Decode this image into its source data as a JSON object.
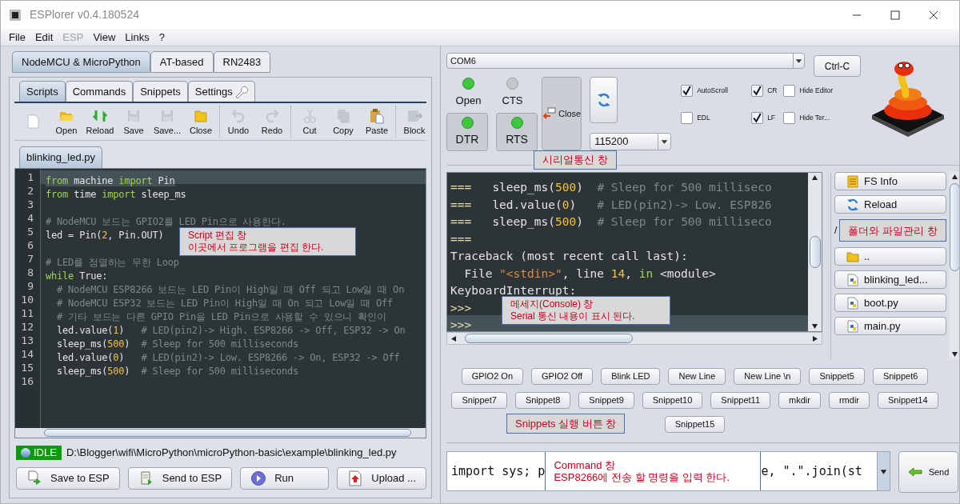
{
  "window": {
    "title": "ESPlorer v0.4.180524"
  },
  "menu": [
    {
      "label": "File",
      "disabled": false
    },
    {
      "label": "Edit",
      "disabled": false
    },
    {
      "label": "ESP",
      "disabled": true
    },
    {
      "label": "View",
      "disabled": false
    },
    {
      "label": "Links",
      "disabled": false
    },
    {
      "label": "?",
      "disabled": false
    }
  ],
  "device_tabs": [
    {
      "label": "NodeMCU & MicroPython",
      "selected": true
    },
    {
      "label": "AT-based",
      "selected": false
    },
    {
      "label": "RN2483",
      "selected": false
    }
  ],
  "editor_tabs": [
    {
      "label": "Scripts",
      "selected": true
    },
    {
      "label": "Commands",
      "selected": false
    },
    {
      "label": "Snippets",
      "selected": false
    },
    {
      "label": "Settings",
      "selected": false,
      "kind": "settings"
    }
  ],
  "toolbar_groups": [
    {
      "items": [
        {
          "kind": "new",
          "disabled": false
        },
        {
          "kind": "open",
          "label": "Open",
          "disabled": false
        },
        {
          "kind": "reload",
          "label": "Reload",
          "disabled": false
        },
        {
          "kind": "save",
          "label": "Save",
          "disabled": true
        },
        {
          "kind": "saveas",
          "label": "Save...",
          "disabled": true
        },
        {
          "kind": "close",
          "label": "Close",
          "disabled": false
        }
      ]
    },
    {
      "items": [
        {
          "kind": "undo",
          "label": "Undo",
          "disabled": true
        },
        {
          "kind": "redo",
          "label": "Redo",
          "disabled": true
        }
      ]
    },
    {
      "items": [
        {
          "kind": "cut",
          "label": "Cut",
          "disabled": true
        },
        {
          "kind": "copy",
          "label": "Copy",
          "disabled": true
        },
        {
          "kind": "paste",
          "label": "Paste",
          "disabled": false
        }
      ]
    },
    {
      "items": [
        {
          "kind": "block",
          "label": "Block",
          "disabled": true
        }
      ]
    }
  ],
  "file_tabs": [
    {
      "label": "blinking_led.py",
      "selected": true
    }
  ],
  "editor": {
    "note": [
      "Script 편집 창",
      "이곳에서 프로그램을 편집 한다."
    ],
    "lines": [
      {
        "number": "1",
        "current": true,
        "tokens": [
          {
            "kind": "keyword",
            "text": "from"
          },
          {
            "kind": "text",
            "text": " machine "
          },
          {
            "kind": "keyword",
            "text": "import"
          },
          {
            "kind": "text",
            "text": " Pin"
          }
        ]
      },
      {
        "number": "2",
        "current": false,
        "tokens": [
          {
            "kind": "keyword",
            "text": "from"
          },
          {
            "kind": "text",
            "text": " time "
          },
          {
            "kind": "keyword",
            "text": "import"
          },
          {
            "kind": "text",
            "text": " sleep_ms"
          }
        ]
      },
      {
        "number": "3"
      },
      {
        "number": "4",
        "current": false,
        "tokens": [
          {
            "kind": "comment",
            "text": "# NodeMCU 보드는 GPIO2를 LED Pin으로 사용한다."
          }
        ]
      },
      {
        "number": "5",
        "current": false,
        "tokens": [
          {
            "kind": "text",
            "text": "led = Pin("
          },
          {
            "kind": "number",
            "text": "2"
          },
          {
            "kind": "text",
            "text": ", Pin.OUT)"
          }
        ]
      },
      {
        "number": "6"
      },
      {
        "number": "7",
        "current": false,
        "tokens": [
          {
            "kind": "comment",
            "text": "# LED를 점멸하는 무한 Loop"
          }
        ]
      },
      {
        "number": "8",
        "current": false,
        "tokens": [
          {
            "kind": "keyword",
            "text": "while"
          },
          {
            "kind": "text",
            "text": " True:"
          }
        ]
      },
      {
        "number": "9",
        "current": false,
        "tokens": [
          {
            "kind": "comment",
            "text": "  # NodeMCU ESP8266 보드는 LED Pin이 High일 때 Off 되고 Low일 때 On"
          }
        ]
      },
      {
        "number": "10",
        "current": false,
        "tokens": [
          {
            "kind": "comment",
            "text": "  # NodeMCU ESP32 보드는 LED Pin이 High일 때 On 되고 Low일 때 Off"
          }
        ]
      },
      {
        "number": "11",
        "current": false,
        "tokens": [
          {
            "kind": "comment",
            "text": "  # 기타 보드는 다른 GPIO Pin을 LED Pin으로 사용할 수 있으니 확인이"
          }
        ]
      },
      {
        "number": "12",
        "current": false,
        "tokens": [
          {
            "kind": "text",
            "text": "  led.value("
          },
          {
            "kind": "number",
            "text": "1"
          },
          {
            "kind": "text",
            "text": ")   "
          },
          {
            "kind": "comment",
            "text": "# LED(pin2)-> High. ESP8266 -> Off, ESP32 -> On"
          }
        ]
      },
      {
        "number": "13",
        "current": false,
        "tokens": [
          {
            "kind": "text",
            "text": "  sleep_ms("
          },
          {
            "kind": "number",
            "text": "500"
          },
          {
            "kind": "text",
            "text": ")  "
          },
          {
            "kind": "comment",
            "text": "# Sleep for 500 milliseconds"
          }
        ]
      },
      {
        "number": "14",
        "current": false,
        "tokens": [
          {
            "kind": "text",
            "text": "  led.value("
          },
          {
            "kind": "number",
            "text": "0"
          },
          {
            "kind": "text",
            "text": ")   "
          },
          {
            "kind": "comment",
            "text": "# LED(pin2)-> Low. ESP8266 -> On, ESP32 -> Off"
          }
        ]
      },
      {
        "number": "15",
        "current": false,
        "tokens": [
          {
            "kind": "text",
            "text": "  sleep_ms("
          },
          {
            "kind": "number",
            "text": "500"
          },
          {
            "kind": "text",
            "text": ")  "
          },
          {
            "kind": "comment",
            "text": "# Sleep for 500 milliseconds"
          }
        ]
      },
      {
        "number": "16"
      }
    ]
  },
  "status": {
    "state": "IDLE",
    "path": "D:\\Blogger\\wifi\\MicroPython\\microPython-basic\\example\\blinking_led.py"
  },
  "script_buttons": [
    {
      "kind": "save",
      "label": "Save to ESP"
    },
    {
      "kind": "send",
      "label": "Send to ESP"
    },
    {
      "kind": "run",
      "label": "Run"
    },
    {
      "kind": "upload",
      "label": "Upload ..."
    }
  ],
  "serial": {
    "port": "COM6",
    "ctrl_c": "Ctrl-C",
    "close": "Close",
    "baud": "115200",
    "note": "시리얼통신 창",
    "indicators": [
      {
        "label": "Open",
        "on": true
      },
      {
        "label": "CTS",
        "on": false
      }
    ],
    "line_buttons": [
      {
        "label": "DTR",
        "on": true
      },
      {
        "label": "RTS",
        "on": true
      }
    ],
    "options": [
      {
        "label": "AutoScroll",
        "checked": true
      },
      {
        "label": "CR",
        "checked": true
      },
      {
        "label": "Hide Editor",
        "checked": false
      },
      {
        "label": "EDL",
        "checked": false
      },
      {
        "label": "LF",
        "checked": true
      },
      {
        "label": "Hide Ter...",
        "checked": false
      }
    ]
  },
  "console": {
    "note": [
      "메세지(Console) 창",
      "Serial 통신 내용이 표시 된다."
    ],
    "lines": [
      {
        "current": false,
        "tokens": [
          {
            "kind": "prompt",
            "text": "===   "
          },
          {
            "kind": "text",
            "text": "sleep_ms("
          },
          {
            "kind": "number",
            "text": "500"
          },
          {
            "kind": "text",
            "text": ")  "
          },
          {
            "kind": "comment",
            "text": "# Sleep for 500 milliseco"
          }
        ]
      },
      {
        "current": false,
        "tokens": [
          {
            "kind": "prompt",
            "text": "===   "
          },
          {
            "kind": "text",
            "text": "led.value("
          },
          {
            "kind": "number",
            "text": "0"
          },
          {
            "kind": "text",
            "text": ")   "
          },
          {
            "kind": "comment",
            "text": "# LED(pin2)-> Low. ESP826"
          }
        ]
      },
      {
        "current": false,
        "tokens": [
          {
            "kind": "prompt",
            "text": "===   "
          },
          {
            "kind": "text",
            "text": "sleep_ms("
          },
          {
            "kind": "number",
            "text": "500"
          },
          {
            "kind": "text",
            "text": ")  "
          },
          {
            "kind": "comment",
            "text": "# Sleep for 500 milliseco"
          }
        ]
      },
      {
        "current": false,
        "tokens": [
          {
            "kind": "prompt",
            "text": "==="
          }
        ]
      },
      {
        "current": false,
        "tokens": [
          {
            "kind": "text",
            "text": "Traceback (most recent call last):"
          }
        ]
      },
      {
        "current": false,
        "tokens": [
          {
            "kind": "text",
            "text": "  File "
          },
          {
            "kind": "string",
            "text": "\"<stdin>\""
          },
          {
            "kind": "text",
            "text": ", line "
          },
          {
            "kind": "number",
            "text": "14"
          },
          {
            "kind": "text",
            "text": ", "
          },
          {
            "kind": "keyword",
            "text": "in"
          },
          {
            "kind": "text",
            "text": " <module>"
          }
        ]
      },
      {
        "current": false,
        "tokens": [
          {
            "kind": "text",
            "text": "KeyboardInterrupt:"
          }
        ]
      },
      {
        "current": false,
        "tokens": [
          {
            "kind": "prompt",
            "text": ">>>"
          }
        ]
      },
      {
        "current": true,
        "tokens": [
          {
            "kind": "prompt",
            "text": ">>>"
          }
        ]
      }
    ]
  },
  "files": {
    "path": "/",
    "note": "폴더와 파일관리 창",
    "buttons": [
      {
        "kind": "info",
        "label": "FS Info"
      },
      {
        "kind": "reload",
        "label": "Reload"
      }
    ],
    "entries": [
      {
        "kind": "folder",
        "label": ".."
      },
      {
        "kind": "script",
        "label": "blinking_led..."
      },
      {
        "kind": "script",
        "label": "boot.py"
      },
      {
        "kind": "script",
        "label": "main.py"
      }
    ]
  },
  "snippets": {
    "note": "Snippets 실행 버튼 창",
    "groups": [
      {
        "buttons": [
          {
            "label": "GPIO2 On"
          },
          {
            "label": "GPIO2 Off"
          },
          {
            "label": "Blink LED"
          },
          {
            "label": "New Line"
          },
          {
            "label": "New Line \\n"
          },
          {
            "label": "Snippet5"
          },
          {
            "label": "Snippet6"
          }
        ]
      },
      {
        "buttons": [
          {
            "label": "Snippet7"
          },
          {
            "label": "Snippet8"
          },
          {
            "label": "Snippet9"
          },
          {
            "label": "Snippet10"
          },
          {
            "label": "Snippet11"
          },
          {
            "label": "mkdir"
          },
          {
            "label": "rmdir"
          },
          {
            "label": "Snippet14"
          }
        ]
      },
      {
        "buttons": [
          {
            "label": "Snippet15"
          }
        ]
      }
    ]
  },
  "command": {
    "value_parts": [
      "import sys; p",
      "e, \".\".join(st"
    ],
    "note": [
      "Command 창",
      "ESP8266에 전송 할 명령을 입력 한다."
    ],
    "send": "Send"
  }
}
